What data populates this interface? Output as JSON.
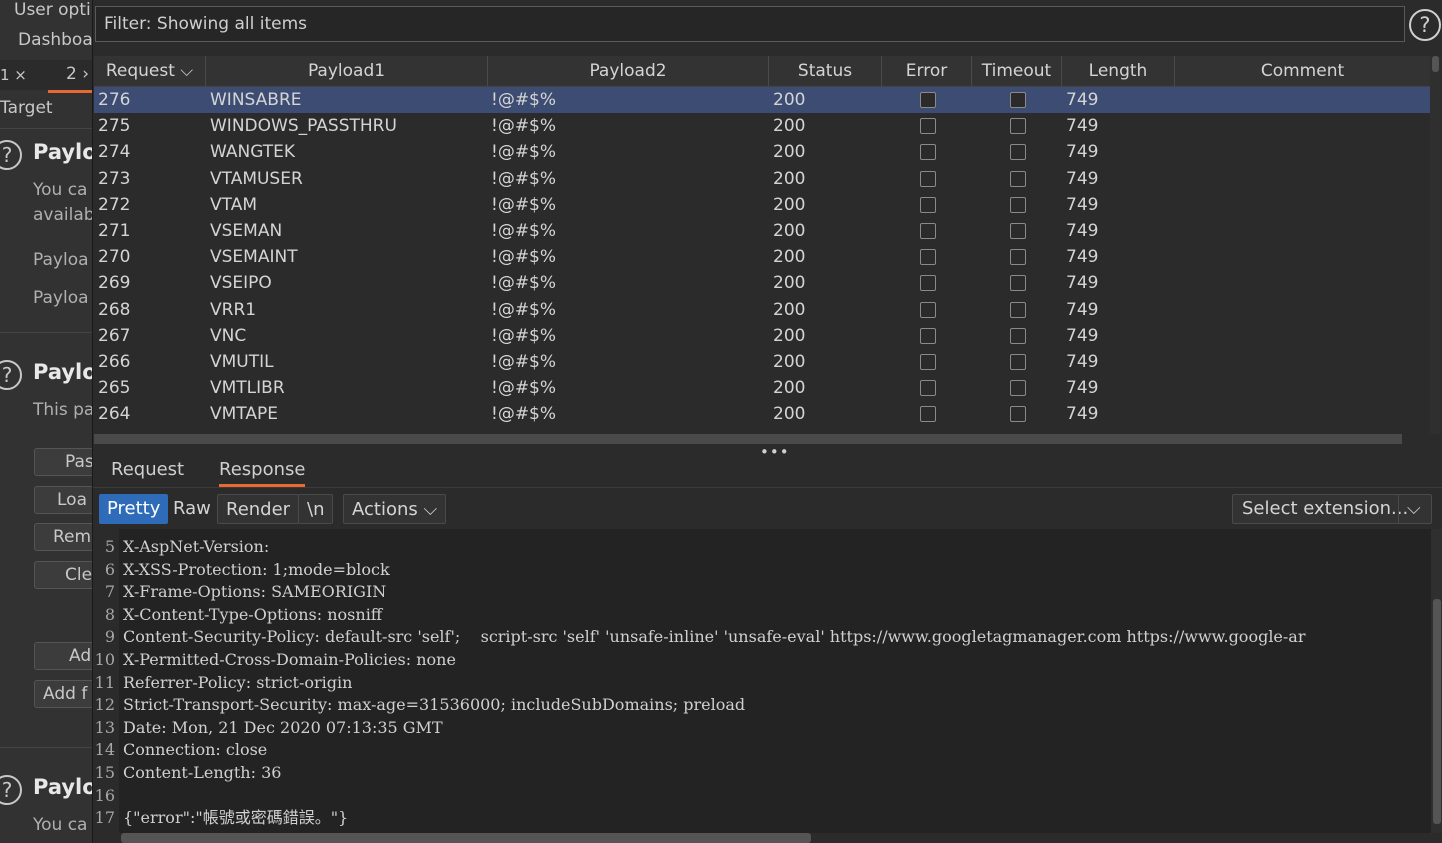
{
  "background": {
    "menu": [
      "User opti",
      "Dashboa"
    ],
    "tabs": [
      "1 ×",
      "2 ›"
    ],
    "target": "Target",
    "sections": [
      {
        "title": "Payloa",
        "lines": [
          "You ca",
          "availab",
          "Payloa",
          "Payloa"
        ]
      },
      {
        "title": "Payloa",
        "lines": [
          "This pa"
        ]
      },
      {
        "title": "Payloa",
        "lines": [
          "You ca"
        ]
      }
    ],
    "buttons": [
      "Pas",
      "Loa",
      "Rem",
      "Cle",
      "Ad",
      "Add f"
    ],
    "help_glyph": "?"
  },
  "filter": {
    "text": "Filter: Showing all items"
  },
  "help_glyph": "?",
  "table": {
    "columns": [
      "Request ⌵",
      "Payload1",
      "Payload2",
      "Status",
      "Error",
      "Timeout",
      "Length",
      "Comment"
    ],
    "rows": [
      {
        "request": "276",
        "payload1": "WINSABRE",
        "payload2": "!@#$%",
        "status": "200",
        "length": "749",
        "selected": true
      },
      {
        "request": "275",
        "payload1": "WINDOWS_PASSTHRU",
        "payload2": "!@#$%",
        "status": "200",
        "length": "749"
      },
      {
        "request": "274",
        "payload1": "WANGTEK",
        "payload2": "!@#$%",
        "status": "200",
        "length": "749"
      },
      {
        "request": "273",
        "payload1": "VTAMUSER",
        "payload2": "!@#$%",
        "status": "200",
        "length": "749"
      },
      {
        "request": "272",
        "payload1": "VTAM",
        "payload2": "!@#$%",
        "status": "200",
        "length": "749"
      },
      {
        "request": "271",
        "payload1": "VSEMAN",
        "payload2": "!@#$%",
        "status": "200",
        "length": "749"
      },
      {
        "request": "270",
        "payload1": "VSEMAINT",
        "payload2": "!@#$%",
        "status": "200",
        "length": "749"
      },
      {
        "request": "269",
        "payload1": "VSEIPO",
        "payload2": "!@#$%",
        "status": "200",
        "length": "749"
      },
      {
        "request": "268",
        "payload1": "VRR1",
        "payload2": "!@#$%",
        "status": "200",
        "length": "749"
      },
      {
        "request": "267",
        "payload1": "VNC",
        "payload2": "!@#$%",
        "status": "200",
        "length": "749"
      },
      {
        "request": "266",
        "payload1": "VMUTIL",
        "payload2": "!@#$%",
        "status": "200",
        "length": "749"
      },
      {
        "request": "265",
        "payload1": "VMTLIBR",
        "payload2": "!@#$%",
        "status": "200",
        "length": "749"
      },
      {
        "request": "264",
        "payload1": "VMTAPE",
        "payload2": "!@#$%",
        "status": "200",
        "length": "749"
      }
    ]
  },
  "divider_glyph": "•••",
  "pane_tabs": [
    "Request",
    "Response"
  ],
  "toolbar": {
    "pretty": "Pretty",
    "raw": "Raw",
    "render": "Render",
    "newline": "\\n",
    "actions": "Actions ⌵",
    "select_extension": "Select extension...",
    "select_caret": "⌵"
  },
  "editor": {
    "lines": [
      {
        "n": "5",
        "text": "X-AspNet-Version:"
      },
      {
        "n": "6",
        "text": "X-XSS-Protection: 1;mode=block"
      },
      {
        "n": "7",
        "text": "X-Frame-Options: SAMEORIGIN"
      },
      {
        "n": "8",
        "text": "X-Content-Type-Options: nosniff"
      },
      {
        "n": "9",
        "text": "Content-Security-Policy: default-src 'self';    script-src 'self' 'unsafe-inline' 'unsafe-eval' https://www.googletagmanager.com https://www.google-ar"
      },
      {
        "n": "10",
        "text": "X-Permitted-Cross-Domain-Policies: none"
      },
      {
        "n": "11",
        "text": "Referrer-Policy: strict-origin"
      },
      {
        "n": "12",
        "text": "Strict-Transport-Security: max-age=31536000; includeSubDomains; preload"
      },
      {
        "n": "13",
        "text": "Date: Mon, 21 Dec 2020 07:13:35 GMT"
      },
      {
        "n": "14",
        "text": "Connection: close"
      },
      {
        "n": "15",
        "text": "Content-Length: 36"
      },
      {
        "n": "16",
        "text": ""
      },
      {
        "n": "17",
        "text": "{\"error\":\"帳號或密碼錯誤。\"}"
      }
    ]
  },
  "colors": {
    "accent": "#e86a33",
    "selection": "#3d4c73",
    "active_button": "#2e6bb8"
  }
}
